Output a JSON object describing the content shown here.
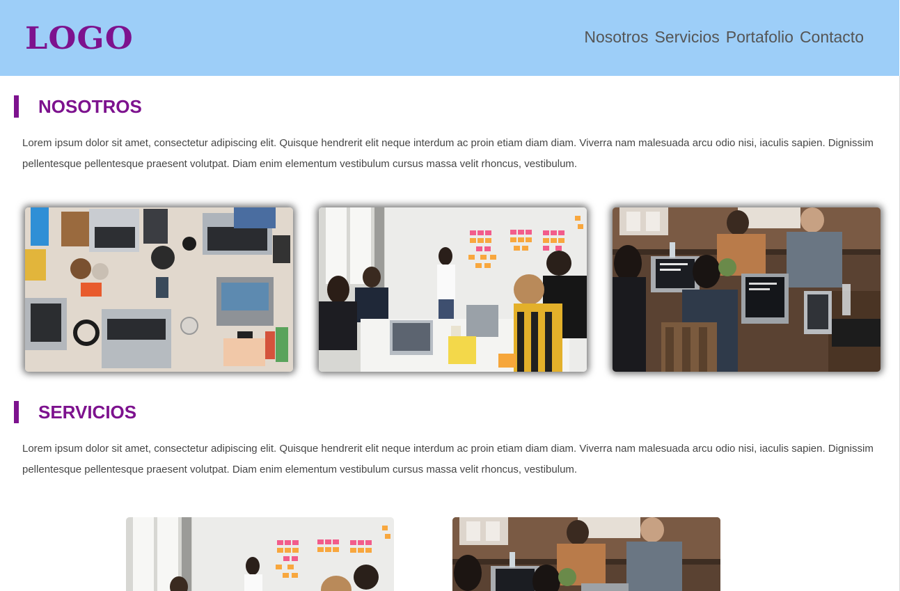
{
  "header": {
    "logo": "LOGO",
    "nav": [
      "Nosotros",
      "Servicios",
      "Portafolio",
      "Contacto"
    ]
  },
  "sections": [
    {
      "title": "NOSOTROS",
      "text": "Lorem ipsum dolor sit amet, consectetur adipiscing elit. Quisque hendrerit elit neque interdum ac proin etiam diam diam. Viverra nam malesuada arcu odio nisi, iaculis sapien. Dignissim pellentesque pellentesque praesent volutpat. Diam enim elementum vestibulum cursus massa velit rhoncus, vestibulum."
    },
    {
      "title": "SERVICIOS",
      "text": "Lorem ipsum dolor sit amet, consectetur adipiscing elit. Quisque hendrerit elit neque interdum ac proin etiam diam diam. Viverra nam malesuada arcu odio nisi, iaculis sapien. Dignissim pellentesque pellentesque praesent volutpat. Diam enim elementum vestibulum cursus massa velit rhoncus, vestibulum."
    }
  ],
  "colors": {
    "header_bg": "#9dcef8",
    "accent": "#7d128e",
    "nav_text": "#555555",
    "body_text": "#454545"
  }
}
